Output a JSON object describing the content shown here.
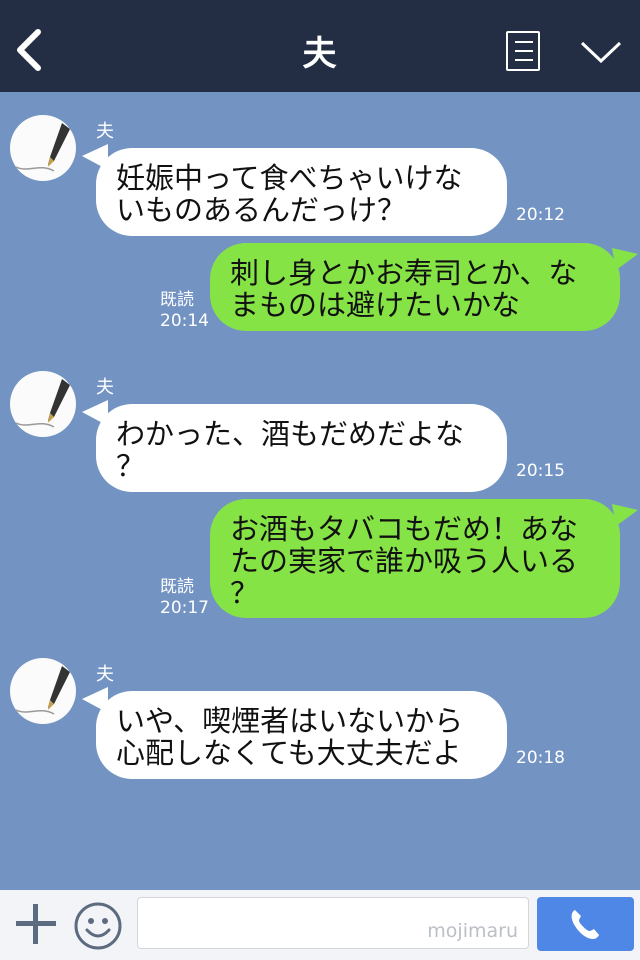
{
  "header": {
    "title": "夫"
  },
  "messages": [
    {
      "side": "in",
      "sender": "夫",
      "text": "妊娠中って食べちゃいけな\nいものあるんだっけ？",
      "time": "20:12"
    },
    {
      "side": "out",
      "read_label": "既読",
      "time": "20:14",
      "text": "刺し身とかお寿司とか、な\nまものは避けたいかな"
    },
    {
      "side": "in",
      "sender": "夫",
      "text": "わかった、酒もだめだよな\n？",
      "time": "20:15"
    },
    {
      "side": "out",
      "read_label": "既読",
      "time": "20:17",
      "text": "お酒もタバコもだめ！あな\nたの実家で誰か吸う人いる\n？"
    },
    {
      "side": "in",
      "sender": "夫",
      "text": "いや、喫煙者はいないから\n心配しなくても大丈夫だよ",
      "time": "20:18"
    }
  ],
  "footer": {
    "watermark": "mojimaru"
  },
  "colors": {
    "header_bg": "#232e45",
    "chat_bg": "#7393c3",
    "bubble_in": "#ffffff",
    "bubble_out": "#86e346",
    "call_button": "#4e87e6"
  },
  "icons": {
    "back": "chevron-left-icon",
    "menu": "list-icon",
    "collapse": "chevron-down-icon",
    "add": "plus-icon",
    "emoji": "smiley-icon",
    "call": "phone-icon",
    "avatar": "fountain-pen-avatar"
  }
}
